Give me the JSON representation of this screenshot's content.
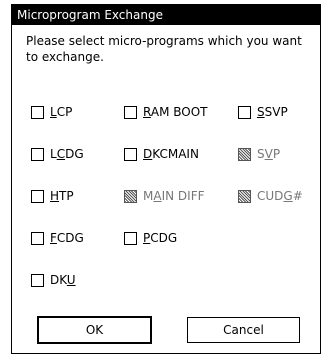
{
  "window": {
    "title": "Microprogram Exchange"
  },
  "message": "Please select micro-programs which you want to exchange.",
  "options": [
    {
      "pre": "",
      "u": "L",
      "post": "CP",
      "checked": false,
      "enabled": true
    },
    {
      "pre": "",
      "u": "R",
      "post": "AM BOOT",
      "checked": false,
      "enabled": true
    },
    {
      "pre": "",
      "u": "S",
      "post": "SVP",
      "checked": false,
      "enabled": true
    },
    {
      "pre": "L",
      "u": "C",
      "post": "DG",
      "checked": false,
      "enabled": true
    },
    {
      "pre": "",
      "u": "D",
      "post": "KCMAIN",
      "checked": false,
      "enabled": true
    },
    {
      "pre": "S",
      "u": "V",
      "post": "P",
      "checked": false,
      "enabled": false
    },
    {
      "pre": "",
      "u": "H",
      "post": "TP",
      "checked": false,
      "enabled": true
    },
    {
      "pre": "M",
      "u": "A",
      "post": "IN DIFF",
      "checked": false,
      "enabled": false
    },
    {
      "pre": "CUD",
      "u": "G",
      "post": "#",
      "checked": false,
      "enabled": false
    },
    {
      "pre": "",
      "u": "F",
      "post": "CDG",
      "checked": false,
      "enabled": true
    },
    {
      "pre": "",
      "u": "P",
      "post": "CDG",
      "checked": false,
      "enabled": true
    },
    {
      "pre": "DK",
      "u": "U",
      "post": "",
      "checked": false,
      "enabled": true
    }
  ],
  "buttons": {
    "ok": "OK",
    "cancel": "Cancel"
  }
}
